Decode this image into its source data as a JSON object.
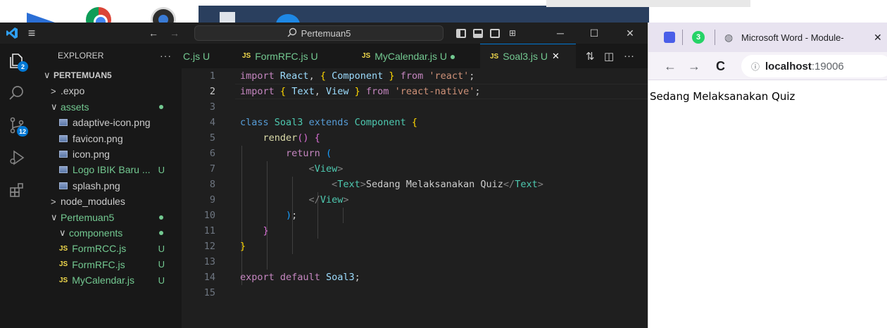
{
  "vscode": {
    "title": {
      "search_text": "Pertemuan5",
      "search_icon": "search-icon",
      "back_icon": "arrow-left-icon",
      "forward_icon": "arrow-right-icon",
      "menu_icon": "hamburger-menu-icon"
    },
    "activity_bar": {
      "explorer_badge": "2",
      "scm_badge": "12"
    },
    "explorer": {
      "header": "EXPLORER",
      "more": "···",
      "items": [
        {
          "label": "PERTEMUAN5",
          "chevron": "∨",
          "flag": ""
        },
        {
          "label": ".expo",
          "chevron": ">",
          "flag": ""
        },
        {
          "label": "assets",
          "chevron": "∨",
          "flag": "dot"
        },
        {
          "label": "adaptive-icon.png",
          "chevron": "",
          "flag": ""
        },
        {
          "label": "favicon.png",
          "chevron": "",
          "flag": ""
        },
        {
          "label": "icon.png",
          "chevron": "",
          "flag": ""
        },
        {
          "label": "Logo IBIK Baru ...",
          "chevron": "",
          "flag": "U"
        },
        {
          "label": "splash.png",
          "chevron": "",
          "flag": ""
        },
        {
          "label": "node_modules",
          "chevron": ">",
          "flag": ""
        },
        {
          "label": "Pertemuan5",
          "chevron": "∨",
          "flag": "dot"
        },
        {
          "label": "components",
          "chevron": "∨",
          "flag": "dot"
        },
        {
          "label": "FormRCC.js",
          "chevron": "",
          "flag": "U"
        },
        {
          "label": "FormRFC.js",
          "chevron": "",
          "flag": "U"
        },
        {
          "label": "MyCalendar.js",
          "chevron": "",
          "flag": "U"
        }
      ],
      "js_prefix": "JS"
    },
    "tabs": [
      {
        "label": "C.js U",
        "js": ""
      },
      {
        "label": "FormRFC.js U",
        "js": "JS"
      },
      {
        "label": "MyCalendar.js U ●",
        "js": "JS"
      },
      {
        "label": "Soal3.js U",
        "js": "JS",
        "close": "✕"
      }
    ],
    "tab_more": "···",
    "code_lines": [
      "1",
      "2",
      "3",
      "4",
      "5",
      "6",
      "7",
      "8",
      "9",
      "10",
      "11",
      "12",
      "13",
      "14",
      "15"
    ]
  },
  "browser": {
    "tab_title": "Microsoft Word - Module-",
    "whatsapp_count": "3",
    "close": "✕",
    "url_host": "localhost",
    "url_port": ":19006",
    "page_text": "Sedang Melaksanakan Quiz"
  },
  "colors": {
    "accent": "#0078d4",
    "untracked": "#73c991",
    "js_badge": "#f1d94c"
  }
}
